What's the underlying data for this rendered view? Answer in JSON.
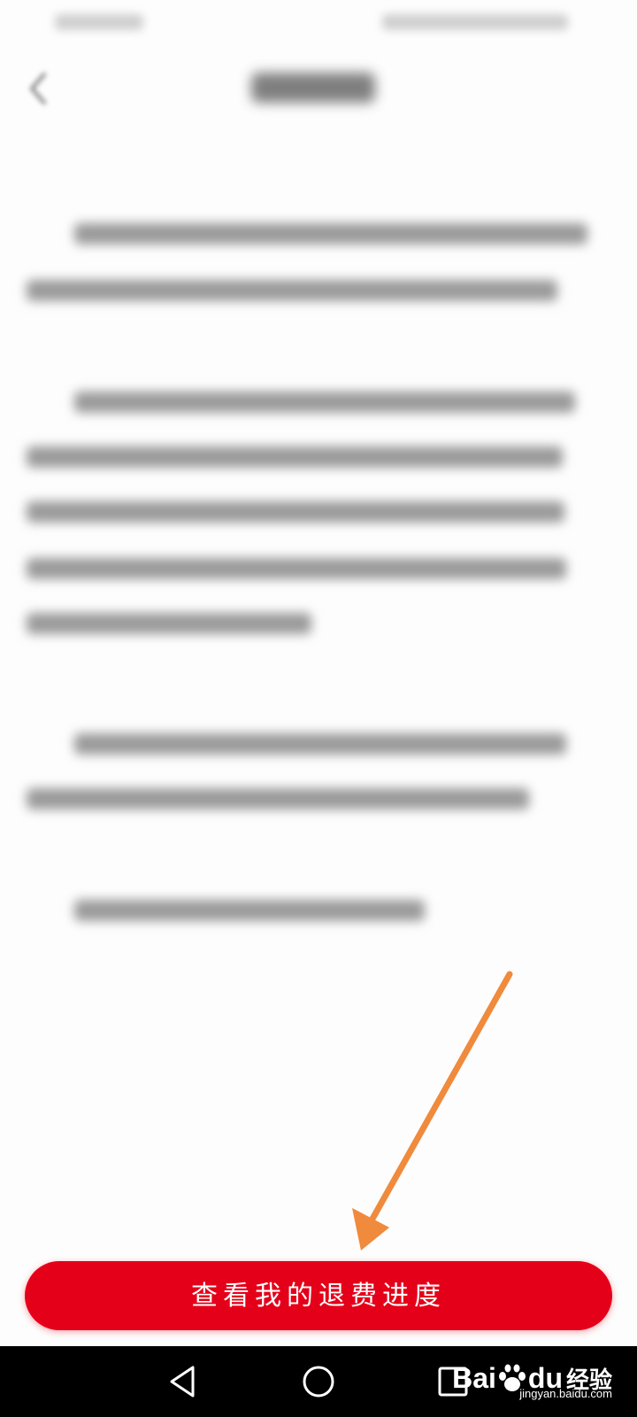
{
  "status_bar": {
    "left_text": "",
    "right_text": ""
  },
  "header": {
    "title": "",
    "back_icon": "chevron-left-icon"
  },
  "content": {
    "paragraphs": [
      "",
      "",
      "",
      ""
    ]
  },
  "button": {
    "label": "查看我的退费进度",
    "color": "#e5001a"
  },
  "annotation": {
    "arrow_color": "#f08a3c"
  },
  "nav_bar": {
    "back_icon": "triangle-back-icon",
    "home_icon": "circle-home-icon",
    "recent_icon": "square-recent-icon"
  },
  "watermark": {
    "brand_text": "Bai",
    "brand_suffix": "du",
    "tag": "经验",
    "url": "jingyan.baidu.com"
  }
}
